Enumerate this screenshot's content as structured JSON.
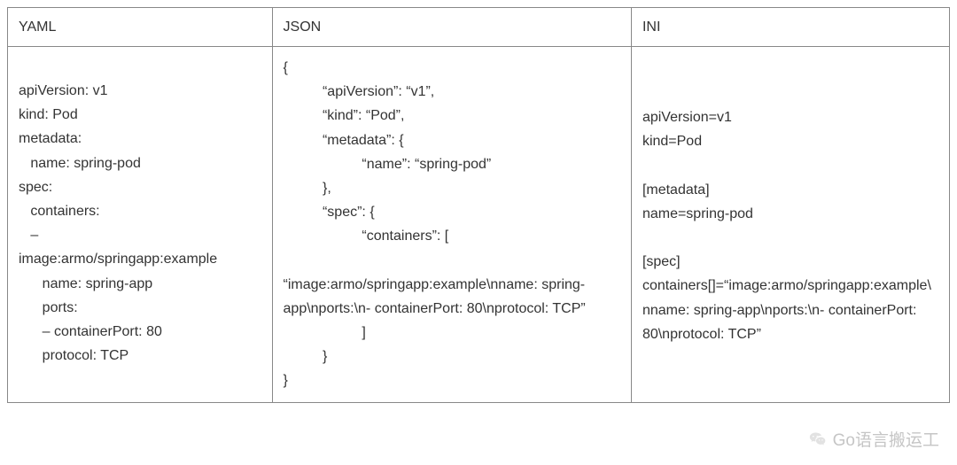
{
  "headers": {
    "yaml": "YAML",
    "json": "JSON",
    "ini": "INI"
  },
  "content": {
    "yaml": "apiVersion: v1\nkind: Pod\nmetadata:\n   name: spring-pod\nspec:\n   containers:\n   –\nimage:armo/springapp:example\n      name: spring-app\n      ports:\n      – containerPort: 80\n      protocol: TCP",
    "json": "{\n          “apiVersion”: “v1”,\n          “kind”: “Pod”,\n          “metadata”: {\n                    “name”: “spring-pod”\n          },\n          “spec”: {\n                    “containers”: [\n\n“image:armo/springapp:example\\nname: spring-app\\nports:\\n- containerPort: 80\\nprotocol: TCP”\n                    ]\n          }\n}",
    "ini": "apiVersion=v1\nkind=Pod\n\n[metadata]\nname=spring-pod\n\n[spec]\ncontainers[]=“image:armo/springapp:example\\nname: spring-app\\nports:\\n- containerPort: 80\\nprotocol: TCP”"
  },
  "watermark": "Go语言搬运工",
  "chart_data": {
    "type": "table",
    "columns": [
      "YAML",
      "JSON",
      "INI"
    ],
    "rows": [
      {
        "YAML": "apiVersion: v1\nkind: Pod\nmetadata:\n  name: spring-pod\nspec:\n  containers:\n  –\nimage:armo/springapp:example\n    name: spring-app\n    ports:\n    – containerPort: 80\n    protocol: TCP",
        "JSON": "{\n  \"apiVersion\": \"v1\",\n  \"kind\": \"Pod\",\n  \"metadata\": {\n    \"name\": \"spring-pod\"\n  },\n  \"spec\": {\n    \"containers\": [\n      \"image:armo/springapp:example\\nname: spring-app\\nports:\\n- containerPort: 80\\nprotocol: TCP\"\n    ]\n  }\n}",
        "INI": "apiVersion=v1\nkind=Pod\n\n[metadata]\nname=spring-pod\n\n[spec]\ncontainers[]=\"image:armo/springapp:example\\nname: spring-app\\nports:\\n- containerPort: 80\\nprotocol: TCP\""
      }
    ]
  }
}
